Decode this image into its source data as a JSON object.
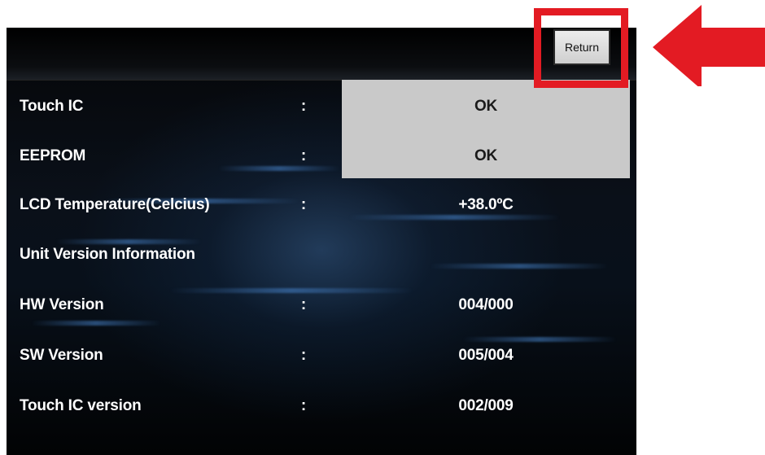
{
  "header": {
    "return_label": "Return"
  },
  "rows": [
    {
      "label": "Touch IC",
      "colon": ":",
      "value": "OK"
    },
    {
      "label": "EEPROM",
      "colon": ":",
      "value": "OK"
    },
    {
      "label": "LCD Temperature(Celcius)",
      "colon": ":",
      "value": "+38.0ºC"
    },
    {
      "label": "Unit Version Information",
      "colon": "",
      "value": ""
    },
    {
      "label": "HW Version",
      "colon": ":",
      "value": "004/000"
    },
    {
      "label": "SW Version",
      "colon": ":",
      "value": "005/004"
    },
    {
      "label": "Touch IC version",
      "colon": ":",
      "value": "002/009"
    }
  ],
  "colors": {
    "highlight": "#e31b23",
    "ok_panel": "#c9c9c9",
    "screen_bg": "#05080d",
    "text": "#ffffff"
  },
  "icons": {
    "pointer": "left-arrow-icon"
  }
}
